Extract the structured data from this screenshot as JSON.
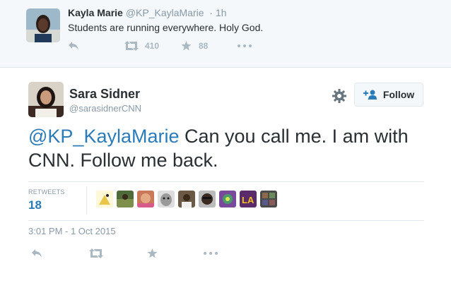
{
  "parent_tweet": {
    "author_name": "Kayla Marie",
    "author_handle": "@KP_KaylaMarie",
    "time": "· 1h",
    "text": "Students are running everywhere. Holy God.",
    "retweet_count": "410",
    "favorite_count": "88",
    "icons": [
      "reply-icon",
      "retweet-icon",
      "favorite-icon",
      "more-icon"
    ]
  },
  "main_tweet": {
    "author_name": "Sara Sidner",
    "author_handle": "@sarasidnerCNN",
    "follow_label": "Follow",
    "mention": "@KP_KaylaMarie",
    "text": " Can you call me. I am with CNN. Follow me back.",
    "retweets_label": "RETWEETS",
    "retweets_count": "18",
    "timestamp": "3:01 PM - 1 Oct 2015",
    "retweeter_avatars": [
      "#e8c64a",
      "#4f6b3a",
      "#c9785a",
      "#9a9a9a",
      "#6b5a45",
      "#3a3a3a",
      "#7a4a9a",
      "#5a3a2a",
      "#4a4a4a"
    ]
  },
  "colors": {
    "link": "#2b7bb9",
    "muted": "#8899a6",
    "icon": "#aab8c2",
    "header_bg": "#f5f8fa"
  }
}
